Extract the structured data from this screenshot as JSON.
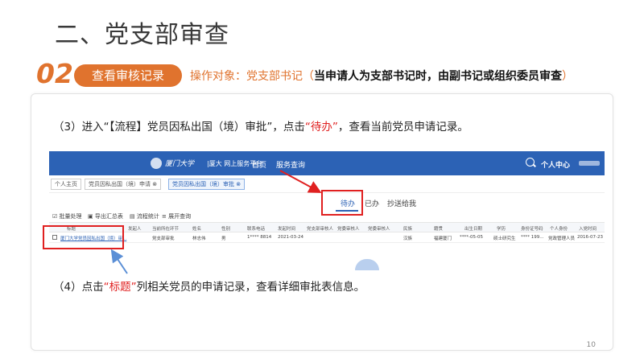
{
  "slide": {
    "title": "二、党支部审查",
    "step_number": "02",
    "step_label": "查看审核记录",
    "step_desc_prefix": "操作对象：党支部书记（",
    "step_desc_bold": "当申请人为支部书记时，由副书记或组织委员审查",
    "step_desc_suffix": "）",
    "instr1_a": "（3）进入“【流程】党员因私出国（境）审批”，点击",
    "instr1_red": "“待办”",
    "instr1_b": "，查看当前党员申请记录。",
    "instr2_a": "（4）点击",
    "instr2_red": "“标题”",
    "instr2_b": "列相关党员的申请记录，查看详细审批表信息。",
    "page_number": "10"
  },
  "screenshot": {
    "logo_text": "厦门大学",
    "platform": "|厦大 网上服务平台",
    "nav": [
      "首页",
      "服务查询"
    ],
    "personal_center": "个人中心",
    "tabs": [
      "个人主页",
      "党员因私出国（境）申请 ⊗",
      "党员因私出国（境）审批 ⊗"
    ],
    "subtabs": [
      "待办",
      "已办",
      "抄送给我"
    ],
    "toolbar": [
      "☑ 批量处理",
      "▣ 导出汇总表",
      "▤ 流程统计",
      "≡ 展开查询"
    ],
    "columns": [
      "标题",
      "发起人",
      "当前所在环节",
      "姓名",
      "性别",
      "联系电话",
      "发起时间",
      "党支部审核人",
      "党委审核人",
      "党委审核人",
      "民族",
      "籍贯",
      "出生日期",
      "学历",
      "身份证号码",
      "个人身份",
      "入党时间"
    ],
    "row": [
      "厦门大学党员因私出国（境）审...",
      "",
      "党支部审批",
      "林志伟",
      "男",
      "1**** 8814",
      "2021-03-24",
      "",
      "",
      "",
      "汉族",
      "福建厦门",
      "****-05-05",
      "硕士研究生",
      "**** 199...",
      "党政管理人员",
      "2016-07-23"
    ]
  },
  "colors": {
    "accent": "#e0732e",
    "nav_blue": "#2c62b5",
    "highlight_red": "#e02020"
  }
}
